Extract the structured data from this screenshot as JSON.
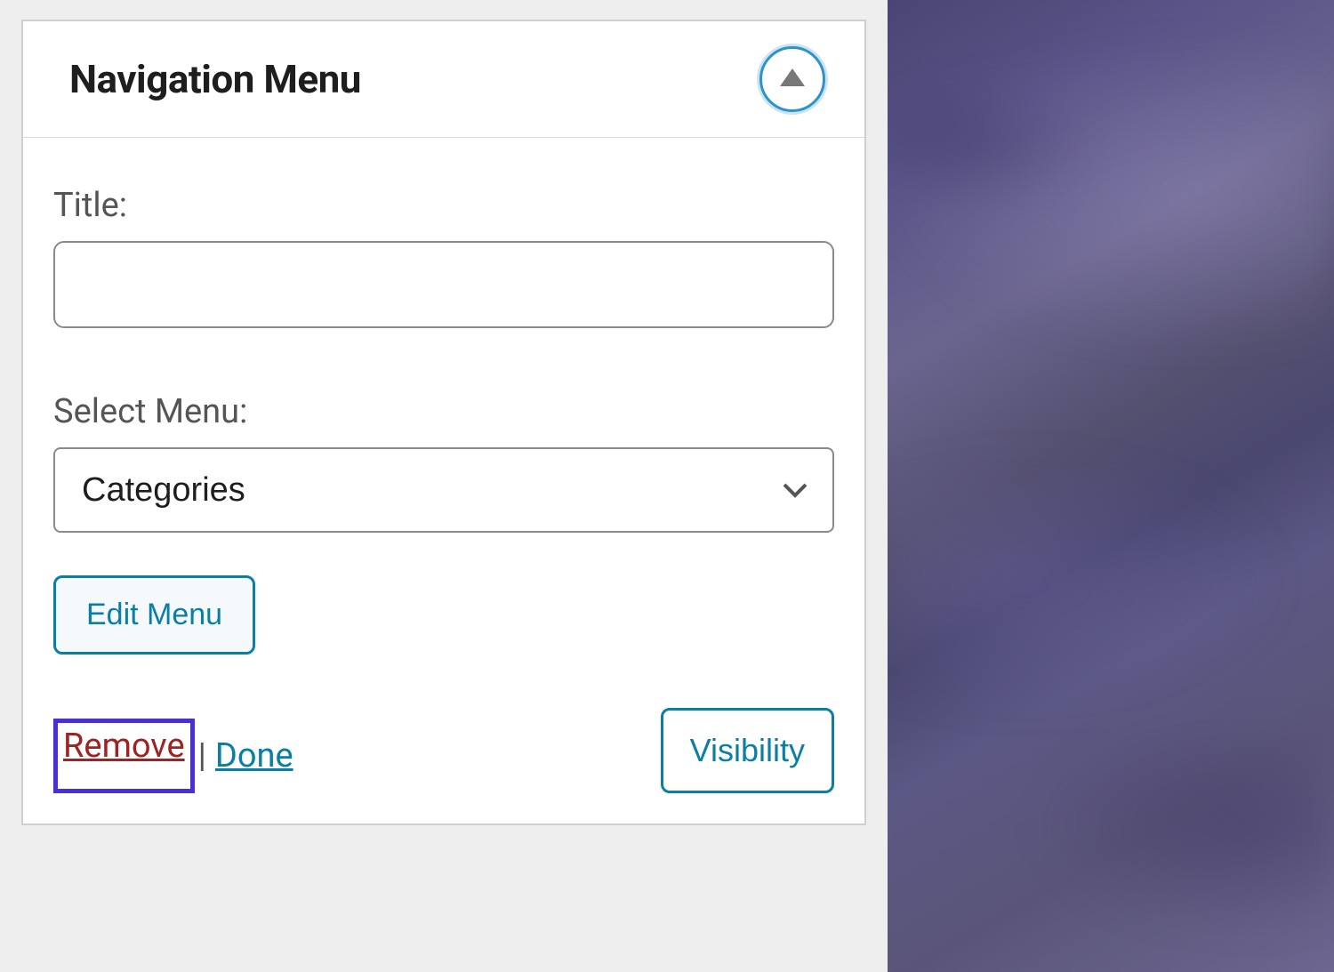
{
  "widget": {
    "title": "Navigation Menu",
    "titleLabel": "Title:",
    "titleValue": "",
    "selectMenuLabel": "Select Menu:",
    "selectMenuValue": "Categories",
    "editMenuLabel": "Edit Menu",
    "removeLabel": "Remove",
    "separator": "|",
    "doneLabel": "Done",
    "visibilityLabel": "Visibility"
  }
}
